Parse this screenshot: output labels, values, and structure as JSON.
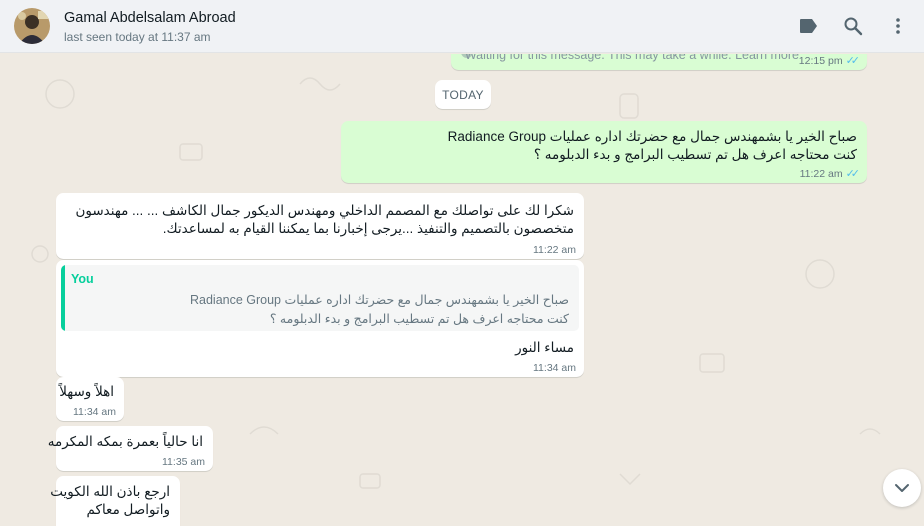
{
  "header": {
    "contact_name": "Gamal Abdelsalam Abroad",
    "status": "last seen today at 11:37 am"
  },
  "icons": {
    "labels": "label-icon",
    "search": "search-icon",
    "menu": "menu-vertical-icon",
    "scroll_down": "chevron-down-icon",
    "read_receipt": "double-check-icon"
  },
  "colors": {
    "outgoing_bubble": "#d9fdd3",
    "incoming_bubble": "#ffffff",
    "chat_background": "#efeae2",
    "quote_accent": "#06cf9c",
    "read_ticks": "#53bdeb"
  },
  "messages": {
    "waiting": {
      "text": "Waiting for this message. This may take a while. Learn more",
      "time": "12:15 pm",
      "ticks": "✓✓"
    },
    "date_divider": "TODAY",
    "m1": {
      "line1": "صباح الخير يا بشمهندس جمال مع حضرتك اداره عمليات Radiance Group",
      "line2": "كنت محتاجه اعرف هل تم تسطيب البرامج و بدء الدبلومه ؟",
      "time": "11:22 am",
      "ticks": "✓✓"
    },
    "m2": {
      "line1": "شكرا لك على تواصلك مع المصمم الداخلي ومهندس الديكور جمال الكاشف ... ... مهندسون",
      "line2": "متخصصون بالتصميم والتنفيذ ...يرجى إخبارنا بما يمكننا القيام به لمساعدتك.",
      "time": "11:22 am"
    },
    "m3": {
      "quote_author": "You",
      "quote_line1": "صباح الخير يا بشمهندس جمال مع حضرتك اداره عمليات Radiance Group",
      "quote_line2": "كنت محتاجه اعرف هل تم تسطيب البرامج و بدء الدبلومه ؟",
      "text": "مساء النور",
      "time": "11:34 am"
    },
    "m4": {
      "text": "اهلاً وسهلاً",
      "time": "11:34 am"
    },
    "m5": {
      "text": "انا حالياً بعمرة بمكه المكرمه",
      "time": "11:35 am"
    },
    "m6": {
      "line1": "ارجع باذن الله الكويت",
      "line2": "واتواصل معاكم"
    }
  }
}
